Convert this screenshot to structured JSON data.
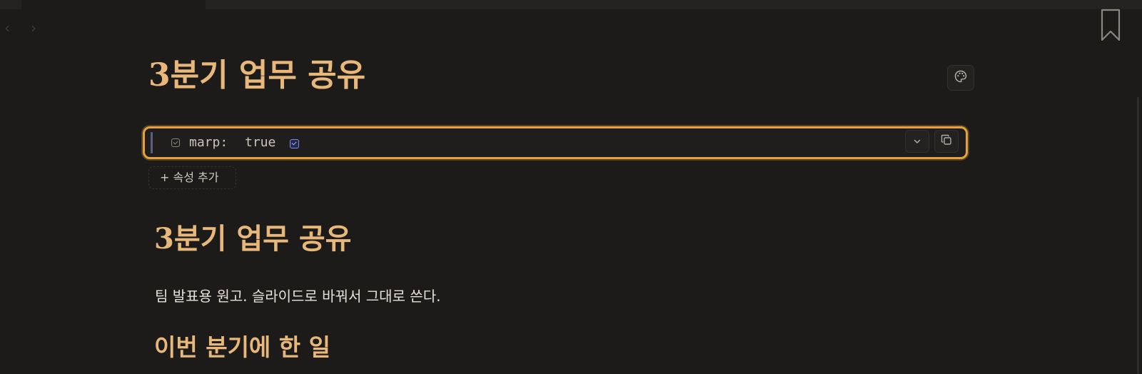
{
  "nav": {
    "back_icon": "‹",
    "forward_icon": "›"
  },
  "note": {
    "title": "3분기 업무 공유",
    "properties": [
      {
        "key": "marp:",
        "value": "true",
        "checked": true
      }
    ],
    "add_property_label": "+ 속성 추가"
  },
  "content": {
    "h1": "3분기 업무 공유",
    "paragraph": "팀 발표용 원고. 슬라이드로 바꿔서 그대로 쓴다.",
    "h2": "이번 분기에 한 일"
  },
  "icons": {
    "back": "chevron-left-icon",
    "forward": "chevron-right-icon",
    "bookmark": "bookmark-icon",
    "palette": "palette-icon",
    "fold": "chevron-down-icon",
    "copy": "copy-icon"
  },
  "colors": {
    "background": "#1c1b1a",
    "heading": "#e8b87a",
    "highlight_border": "#e5a13e",
    "checkbox_accent": "#7f8fe0"
  }
}
